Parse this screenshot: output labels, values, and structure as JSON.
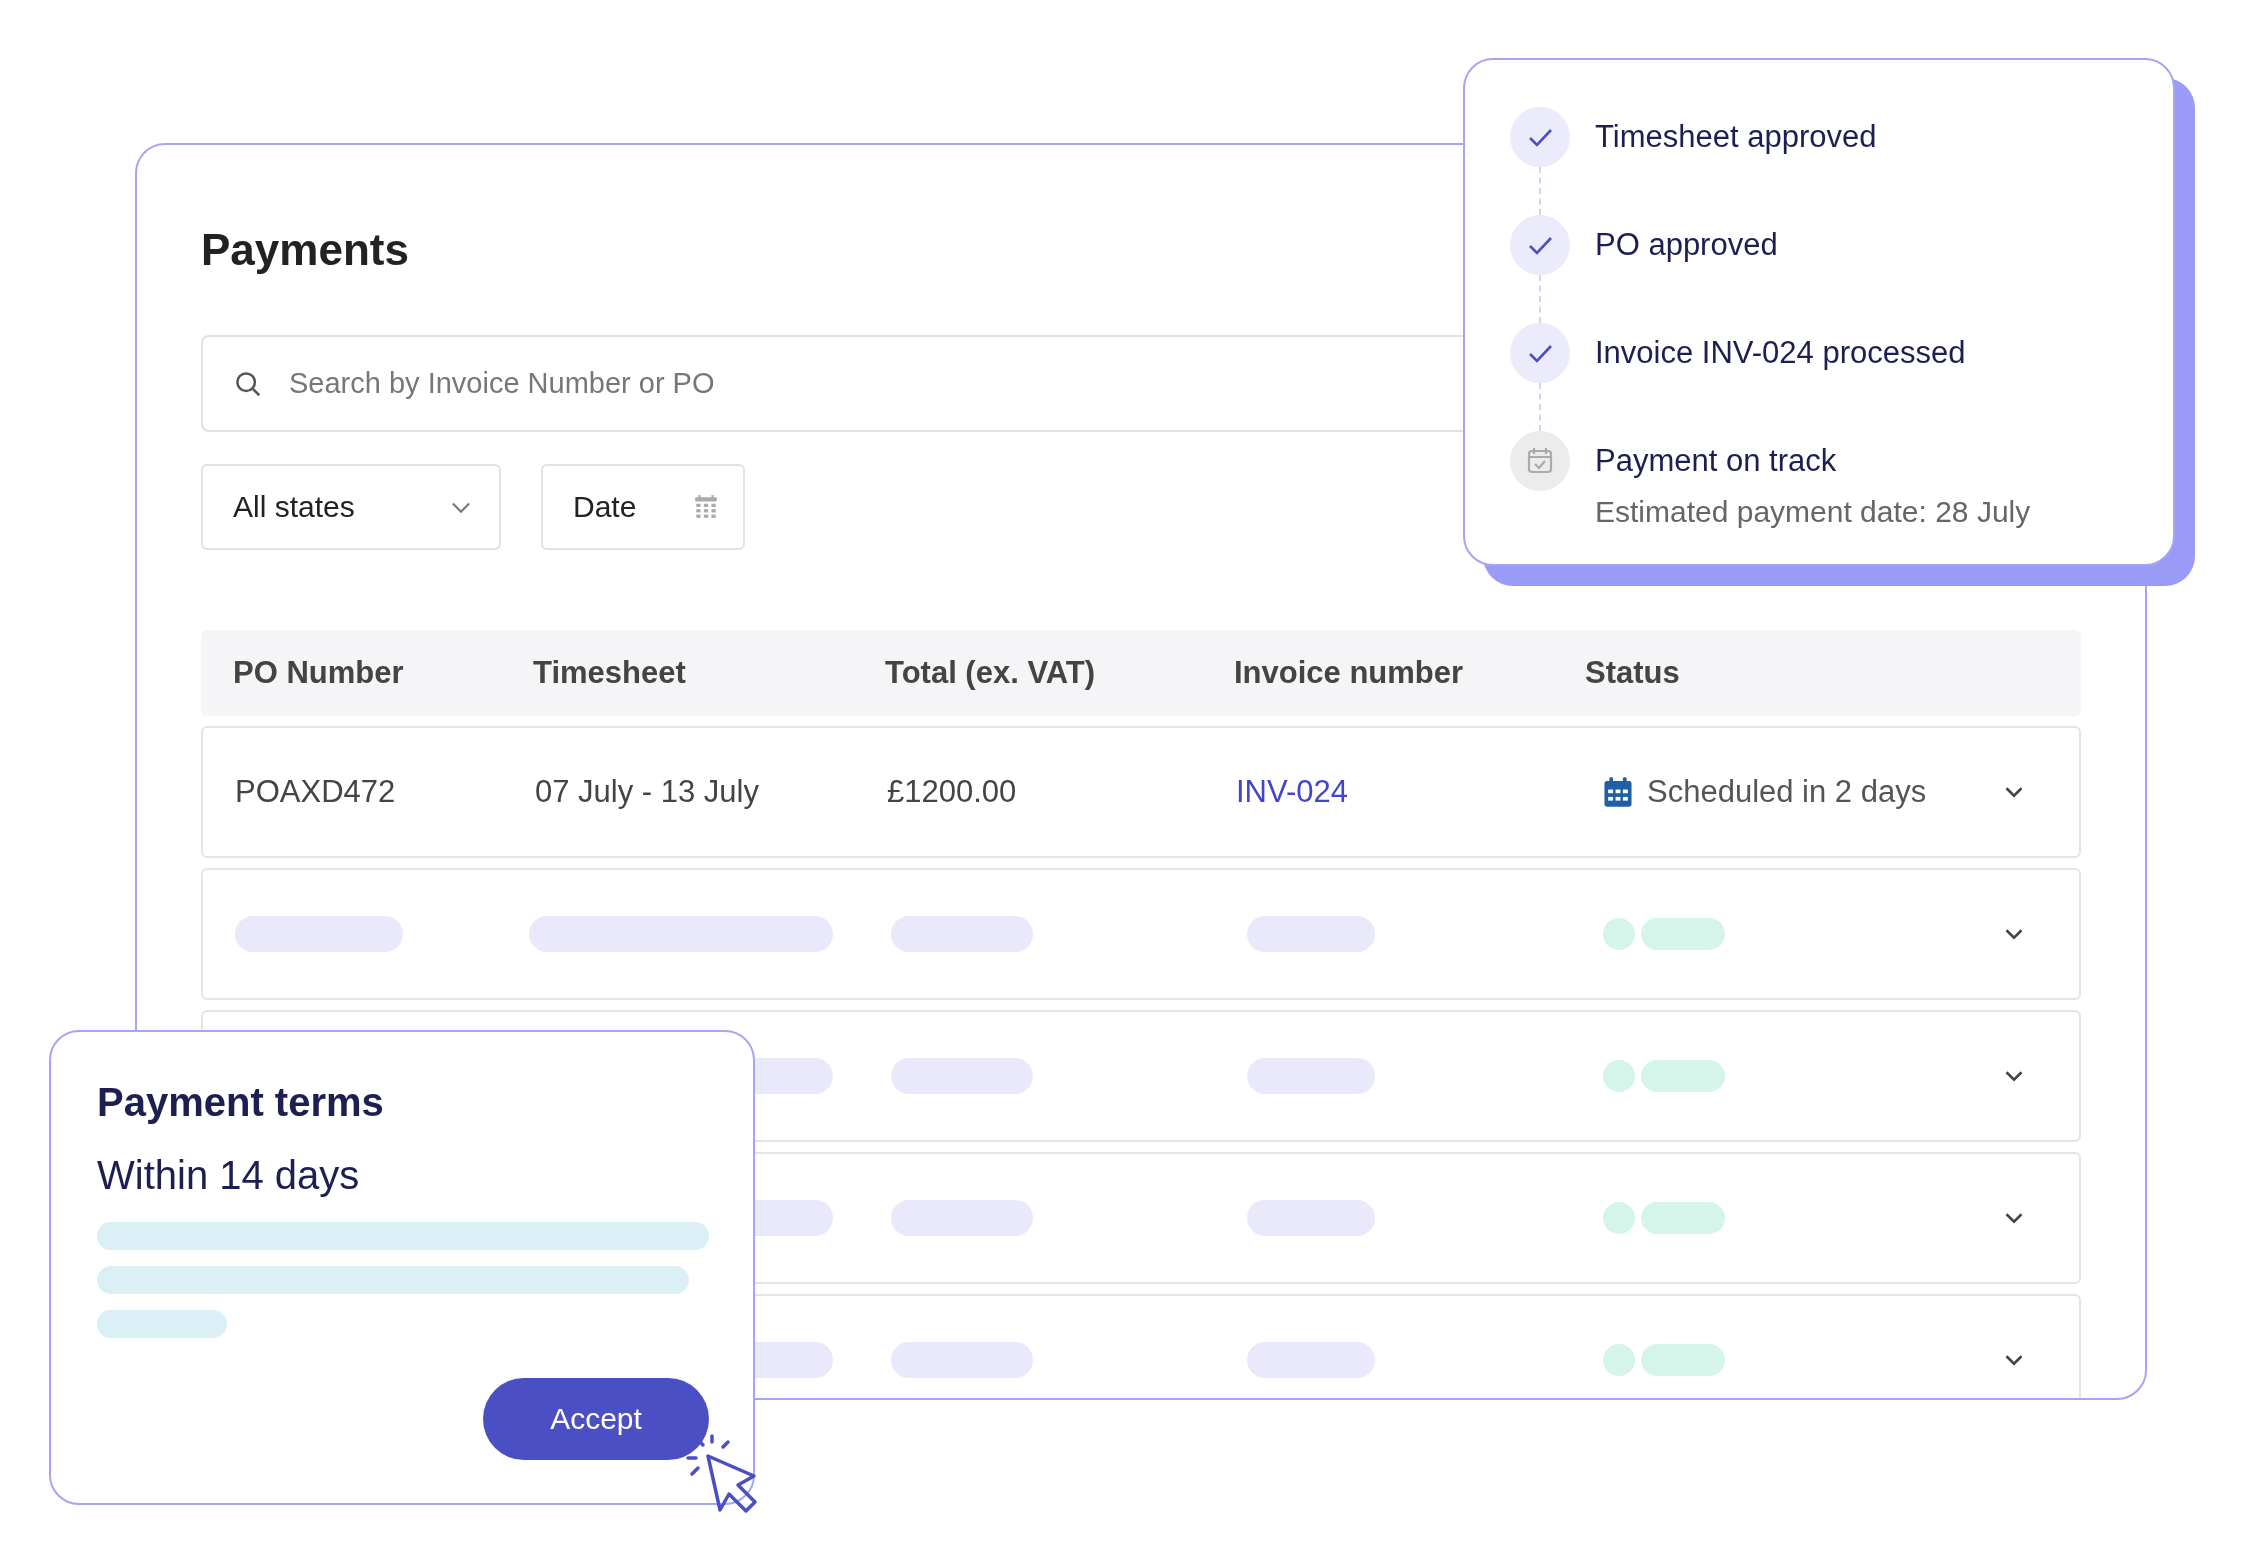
{
  "payments": {
    "title": "Payments",
    "search": {
      "placeholder": "Search by Invoice Number or PO"
    },
    "filters": [
      {
        "kind": "dropdown",
        "label": "All states"
      },
      {
        "kind": "date",
        "label": "Date"
      }
    ],
    "table": {
      "columns": [
        "PO Number",
        "Timesheet",
        "Total (ex. VAT)",
        "Invoice number",
        "Status"
      ],
      "rows": [
        {
          "kind": "data",
          "po_number": "POAXD472",
          "timesheet": "07 July - 13 July",
          "total": "£1200.00",
          "invoice_number": "INV-024",
          "status": "Scheduled in 2 days"
        },
        {
          "kind": "skeleton"
        },
        {
          "kind": "skeleton"
        },
        {
          "kind": "skeleton"
        },
        {
          "kind": "skeleton"
        }
      ]
    }
  },
  "progress": {
    "steps": [
      {
        "label": "Timesheet approved",
        "done": true
      },
      {
        "label": "PO approved",
        "done": true
      },
      {
        "label": "Invoice INV-024 processed",
        "done": true
      },
      {
        "label": "Payment on track",
        "done": false,
        "detail": "Estimated payment date: 28 July"
      }
    ]
  },
  "payment_terms": {
    "title": "Payment terms",
    "value": "Within 14 days",
    "button": "Accept"
  }
}
